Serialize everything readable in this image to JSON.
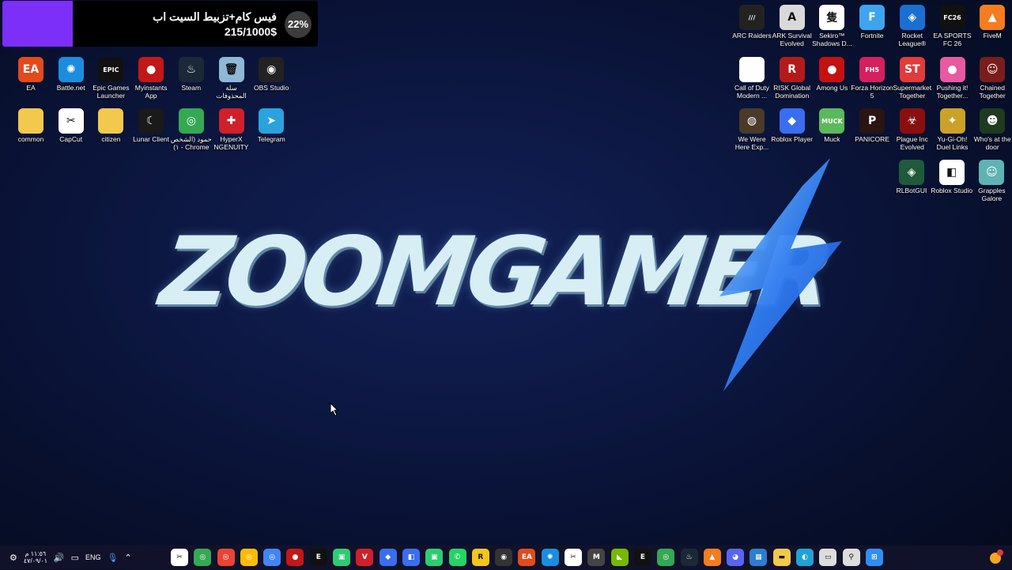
{
  "donation": {
    "title": "فيس كام+تزبيط السيت اب",
    "amount": "215/1000$",
    "percent": "22%",
    "progress": 0.22,
    "bar_color": "#7b2ff7"
  },
  "logo": {
    "text": "ZOOMGAMER"
  },
  "desktop_icons": {
    "left_row1": [
      {
        "label": "EA",
        "icon": "ea-icon",
        "color": "#e24a1c",
        "glyph": "EA"
      },
      {
        "label": "Battle.net",
        "icon": "battlenet-icon",
        "color": "#1a8de0",
        "glyph": "✺"
      },
      {
        "label": "Epic Games Launcher",
        "icon": "epic-games-icon",
        "color": "#111111",
        "glyph": "EPIC"
      },
      {
        "label": "Myinstants App",
        "icon": "myinstants-icon",
        "color": "#c21818",
        "glyph": "●"
      },
      {
        "label": "Steam",
        "icon": "steam-icon",
        "color": "#1b2838",
        "glyph": "♨"
      },
      {
        "label": "سلة المحذوفات",
        "icon": "recycle-bin-icon",
        "color": "#8fb7d6",
        "glyph": "🗑"
      },
      {
        "label": "OBS Studio",
        "icon": "obs-icon",
        "color": "#222222",
        "glyph": "◉"
      }
    ],
    "left_row2": [
      {
        "label": "common",
        "icon": "folder-icon",
        "color": "#f2c94c",
        "glyph": ""
      },
      {
        "label": "CapCut",
        "icon": "capcut-icon",
        "color": "#ffffff",
        "glyph": "✂"
      },
      {
        "label": "citizen",
        "icon": "folder-icon",
        "color": "#f2c94c",
        "glyph": ""
      },
      {
        "label": "Lunar Client",
        "icon": "lunar-client-icon",
        "color": "#1a1a1a",
        "glyph": "☾"
      },
      {
        "label": "حمود (الشخص ١) - Chrome",
        "icon": "chrome-icon",
        "color": "#34a853",
        "glyph": "◎"
      },
      {
        "label": "HyperX NGENUITY",
        "icon": "hyperx-icon",
        "color": "#d0202a",
        "glyph": "✚"
      },
      {
        "label": "Telegram",
        "icon": "telegram-icon",
        "color": "#2aa3dd",
        "glyph": "➤"
      }
    ],
    "right_row1": [
      {
        "label": "ARC Raiders",
        "icon": "arc-raiders-icon",
        "color": "#222222",
        "glyph": "///"
      },
      {
        "label": "ARK Survival Evolved",
        "icon": "ark-icon",
        "color": "#d9d9d9",
        "glyph": "A"
      },
      {
        "label": "Sekiro™ Shadows D...",
        "icon": "sekiro-icon",
        "color": "#ffffff",
        "glyph": "隻"
      },
      {
        "label": "Fortnite",
        "icon": "fortnite-icon",
        "color": "#3ea4f0",
        "glyph": "F"
      },
      {
        "label": "Rocket League®",
        "icon": "rocket-league-icon",
        "color": "#1a6fd1",
        "glyph": "◈"
      },
      {
        "label": "EA SPORTS FC 26",
        "icon": "fc26-icon",
        "color": "#111111",
        "glyph": "FC26"
      },
      {
        "label": "FiveM",
        "icon": "fivem-icon",
        "color": "#f57c1f",
        "glyph": "▲"
      }
    ],
    "right_row2": [
      {
        "label": "Call of Duty Modern ...",
        "icon": "file-icon",
        "color": "#ffffff",
        "glyph": ""
      },
      {
        "label": "RISK Global Domination",
        "icon": "risk-icon",
        "color": "#b31b1b",
        "glyph": "R"
      },
      {
        "label": "Among Us",
        "icon": "among-us-icon",
        "color": "#c51111",
        "glyph": "●"
      },
      {
        "label": "Forza Horizon 5",
        "icon": "forza-icon",
        "color": "#d6205e",
        "glyph": "FH5"
      },
      {
        "label": "Supermarket Together",
        "icon": "supermarket-icon",
        "color": "#e23b3b",
        "glyph": "ST"
      },
      {
        "label": "Pushing it! Together...",
        "icon": "pushing-it-icon",
        "color": "#e85aa0",
        "glyph": "●"
      },
      {
        "label": "Chained Together",
        "icon": "chained-together-icon",
        "color": "#7a1d1d",
        "glyph": "☺"
      }
    ],
    "right_row3": [
      {
        "label": "We Were Here Exp...",
        "icon": "we-were-here-icon",
        "color": "#4a3a2a",
        "glyph": "◍"
      },
      {
        "label": "Roblox Player",
        "icon": "roblox-icon",
        "color": "#3a6df0",
        "glyph": "◆"
      },
      {
        "label": "Muck",
        "icon": "muck-icon",
        "color": "#5cb85c",
        "glyph": "MUCK"
      },
      {
        "label": "PANICORE",
        "icon": "panicore-icon",
        "color": "#2a1414",
        "glyph": "P"
      },
      {
        "label": "Plague Inc Evolved",
        "icon": "plague-inc-icon",
        "color": "#8a0f0f",
        "glyph": "☣"
      },
      {
        "label": "Yu-Gi-Oh! Duel Links",
        "icon": "yugioh-icon",
        "color": "#c9a227",
        "glyph": "✦"
      },
      {
        "label": "Who's at the door",
        "icon": "whos-at-door-icon",
        "color": "#1f3a1f",
        "glyph": "☻"
      }
    ],
    "right_row4": [
      {
        "label": "RLBotGUI",
        "icon": "rlbot-icon",
        "color": "#1f5a3a",
        "glyph": "◈"
      },
      {
        "label": "Roblox Studio",
        "icon": "roblox-studio-icon",
        "color": "#ffffff",
        "glyph": "◧"
      },
      {
        "label": "Grapples Galore",
        "icon": "grapples-icon",
        "color": "#5fb3b3",
        "glyph": "☺"
      }
    ]
  },
  "taskbar": {
    "time": "١١:٥٦ م",
    "date": "٤٧/٠٩/٠١",
    "language": "ENG",
    "apps": [
      {
        "icon": "capcut-icon",
        "color": "#ffffff",
        "glyph": "✂"
      },
      {
        "icon": "chrome-icon",
        "color": "#34a853",
        "glyph": "◎"
      },
      {
        "icon": "chrome-icon",
        "color": "#ea4335",
        "glyph": "◎"
      },
      {
        "icon": "chrome-icon",
        "color": "#fbbc05",
        "glyph": "◎"
      },
      {
        "icon": "chrome-icon",
        "color": "#4285f4",
        "glyph": "◎"
      },
      {
        "icon": "myinstants-icon",
        "color": "#c21818",
        "glyph": "●"
      },
      {
        "icon": "epic-games-icon",
        "color": "#111111",
        "glyph": "E"
      },
      {
        "icon": "app-icon",
        "color": "#2ecc71",
        "glyph": "▣"
      },
      {
        "icon": "voicemod-icon",
        "color": "#d0202a",
        "glyph": "V"
      },
      {
        "icon": "roblox-icon",
        "color": "#3a6df0",
        "glyph": "◆"
      },
      {
        "icon": "roblox-studio-icon",
        "color": "#3a6df0",
        "glyph": "◧"
      },
      {
        "icon": "app-icon",
        "color": "#2ecc71",
        "glyph": "▣"
      },
      {
        "icon": "whatsapp-icon",
        "color": "#25d366",
        "glyph": "✆"
      },
      {
        "icon": "rockstar-icon",
        "color": "#f5c518",
        "glyph": "R"
      },
      {
        "icon": "obs-icon",
        "color": "#333333",
        "glyph": "◉"
      },
      {
        "icon": "ea-icon",
        "color": "#e24a1c",
        "glyph": "EA"
      },
      {
        "icon": "battlenet-icon",
        "color": "#1a8de0",
        "glyph": "✺"
      },
      {
        "icon": "capcut-icon",
        "color": "#ffffff",
        "glyph": "✂"
      },
      {
        "icon": "app-icon",
        "color": "#444444",
        "glyph": "M"
      },
      {
        "icon": "nvidia-icon",
        "color": "#76b900",
        "glyph": "◣"
      },
      {
        "icon": "epic-games-icon",
        "color": "#111111",
        "glyph": "E"
      },
      {
        "icon": "chrome-icon",
        "color": "#34a853",
        "glyph": "◎"
      },
      {
        "icon": "steam-icon",
        "color": "#1b2838",
        "glyph": "♨"
      },
      {
        "icon": "fivem-icon",
        "color": "#f57c1f",
        "glyph": "▲"
      },
      {
        "icon": "discord-icon",
        "color": "#5865f2",
        "glyph": "◕"
      },
      {
        "icon": "store-icon",
        "color": "#2d7dd2",
        "glyph": "▦"
      },
      {
        "icon": "file-explorer-icon",
        "color": "#f2c94c",
        "glyph": "▬"
      },
      {
        "icon": "edge-icon",
        "color": "#1fa3d6",
        "glyph": "◐"
      },
      {
        "icon": "task-view-icon",
        "color": "#dddddd",
        "glyph": "▭"
      },
      {
        "icon": "search-icon",
        "color": "#dddddd",
        "glyph": "⚲"
      },
      {
        "icon": "windows-start-icon",
        "color": "#2f8ef4",
        "glyph": "⊞"
      }
    ]
  }
}
